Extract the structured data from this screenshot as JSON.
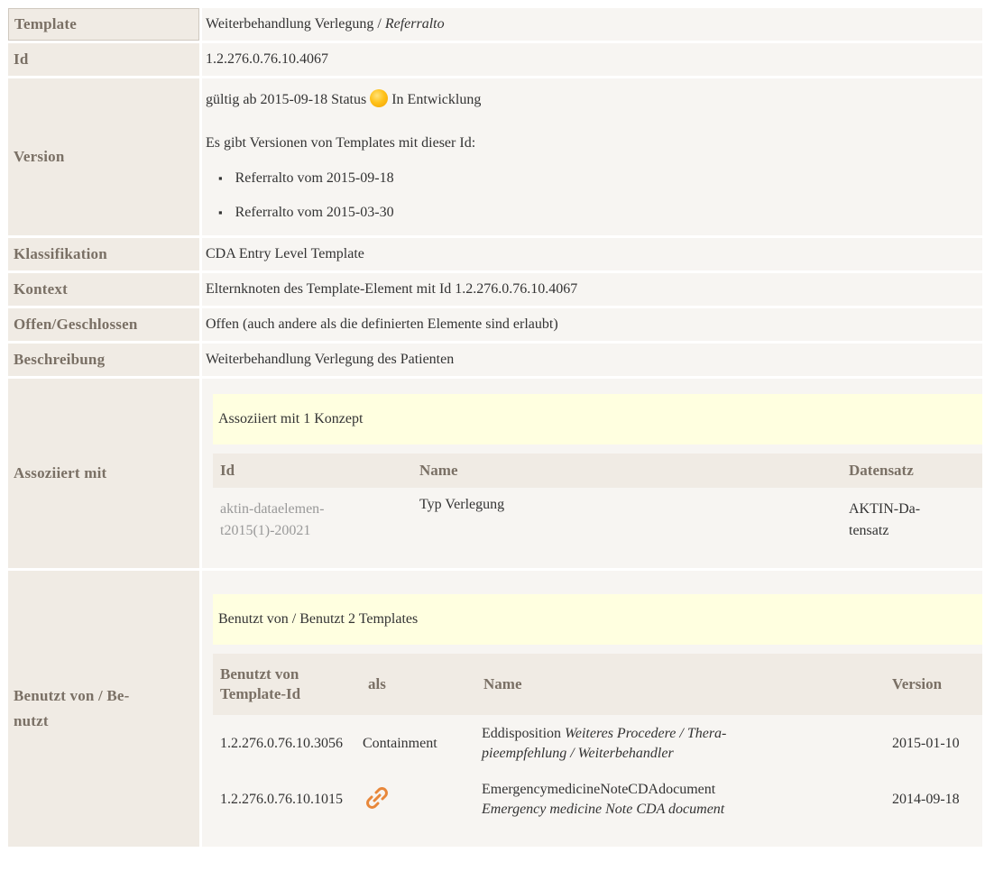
{
  "rows": {
    "template": {
      "label": "Template",
      "name": "Weiterbehandlung Verlegung",
      "separator": "/",
      "alias": "Referralto"
    },
    "id": {
      "label": "Id",
      "value": "1.2.276.0.76.10.4067"
    },
    "version": {
      "label": "Version",
      "valid_from": "gültig ab 2015-09-18 Status",
      "status_text": "In Entwicklung",
      "status_color": "#ffc21a",
      "versions_intro": "Es gibt Versionen von Templates mit dieser Id:",
      "versions": [
        "Referralto vom 2015-09-18",
        "Referralto vom 2015-03-30"
      ]
    },
    "classification": {
      "label": "Klassifikation",
      "value": "CDA Entry Level Template"
    },
    "context": {
      "label": "Kontext",
      "value": "Elternknoten des Template-Element mit Id 1.2.276.0.76.10.4067"
    },
    "open": {
      "label": "Offen/Geschlossen",
      "value": "Offen (auch andere als die definierten Elemente sind erlaubt)"
    },
    "description": {
      "label": "Beschreibung",
      "value": "Weiterbehandlung Verlegung des Patienten"
    },
    "associated": {
      "label": "Assoziiert mit",
      "banner": "Assoziiert mit 1 Konzept",
      "headers": {
        "id": "Id",
        "name": "Name",
        "dataset": "Datensatz"
      },
      "items": [
        {
          "id_line1": "aktin-dataelemen-",
          "id_line2": "t2015(1)-20021",
          "name": "Typ Verlegung",
          "dataset_line1": "AKTIN-Da-",
          "dataset_line2": "tensatz"
        }
      ]
    },
    "used_by": {
      "label_line1": "Benutzt von / Be-",
      "label_line2": "nutzt",
      "banner": "Benutzt von / Benutzt 2 Templates",
      "headers": {
        "template_id_line1": "Benutzt von",
        "template_id_line2": "Template-Id",
        "as": "als",
        "name": "Name",
        "version": "Version"
      },
      "items": [
        {
          "template_id": "1.2.276.0.76.10.3056",
          "as": "Containment",
          "name": "Eddisposition",
          "alias_line1": "Weiteres Procedere / Thera-",
          "alias_line2": "pieempfehlung / Weiterbehandler",
          "version": "2015-01-10"
        },
        {
          "template_id": "1.2.276.0.76.10.1015",
          "as_icon": "chain-link-icon",
          "name": "EmergencymedicineNoteCDAdocument",
          "alias_line1": "Emergency medicine Note CDA document",
          "version": "2014-09-18"
        }
      ]
    }
  },
  "colors": {
    "label_bg": "#f0ebe4",
    "value_bg": "#f7f5f2",
    "banner_bg": "#ffffe0",
    "label_text": "#7a7065",
    "link_icon": "#e8873a"
  }
}
